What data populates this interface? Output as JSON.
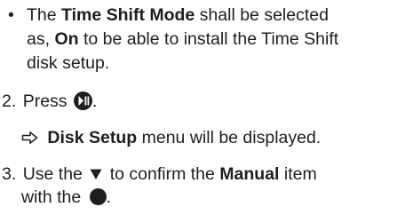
{
  "bullet_item": {
    "marker": "•",
    "line1_pre": "The ",
    "line1_bold": "Time Shift Mode",
    "line1_post": " shall be selected",
    "line2_pre": "as, ",
    "line2_bold": "On",
    "line2_post": " to be able to install the Time Shift",
    "line3": "disk setup."
  },
  "step2": {
    "number": "2.",
    "text_pre": "Press ",
    "text_post": ".",
    "icon": "play-pause-button-icon"
  },
  "result": {
    "arrow_icon": "result-arrow-icon",
    "bold": "Disk Setup",
    "text": " menu will be displayed."
  },
  "step3": {
    "number": "3.",
    "line1_pre": "Use the ",
    "down_icon": "down-triangle-icon",
    "line1_mid": " to confirm the ",
    "line1_bold": "Manual",
    "line1_post": " item",
    "line2_pre": "with the ",
    "line2_icon": "ok-button-icon",
    "line2_post": "."
  }
}
